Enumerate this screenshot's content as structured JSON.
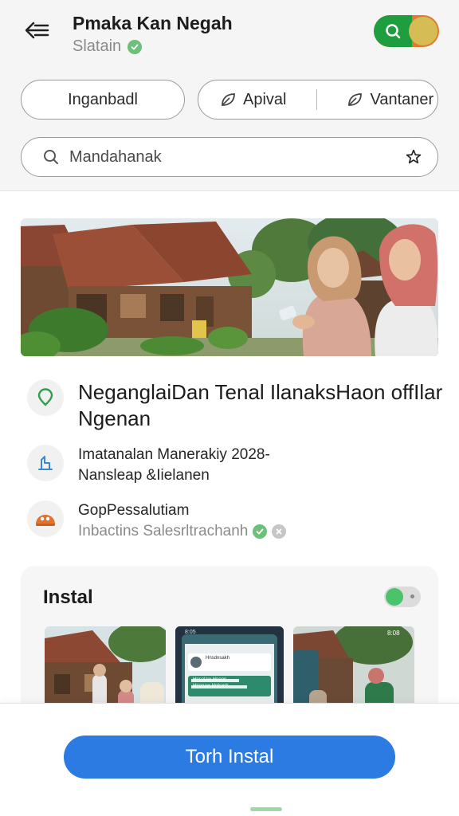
{
  "header": {
    "title": "Pmaka Kan Negah",
    "subtitle": "Slatain"
  },
  "chips": {
    "primary": "Inganbadl",
    "second": "Apival",
    "third": "Vantaner"
  },
  "search": {
    "placeholder": "Mandahanak"
  },
  "info": {
    "headline": "NeganglaiDan Tenal IlanaksHaon offIlar Ngenan",
    "date_line": "Imatanalan Manerakiy 2028-",
    "location_line": "Nansleap &Iielanen",
    "group_title": "GopPessalutiam",
    "group_sub": "Inbactins Salesrltrachanh"
  },
  "card": {
    "title": "Instal",
    "phone_header": "Hnsdnsakh",
    "phone_line1": "Hnsolaw Hnenn",
    "phone_line2": "Hnanaw Hnbanh",
    "status_time": "8:05",
    "status_time_right": "8:08"
  },
  "cta": {
    "label": "Torh Instal"
  },
  "colors": {
    "accent_blue": "#2b7be3",
    "toggle_green": "#1e9e3e",
    "toggle_orange": "#e07a2e",
    "toggle_knob": "#d6bc55",
    "verified_green": "#6dc07a"
  },
  "icons": {
    "back": "arrow-left-icon",
    "search": "search-icon",
    "favorite": "star-outline-icon",
    "chip": "leaf-icon",
    "location": "map-pin-icon",
    "calendar": "calendar-icon",
    "group": "group-icon"
  }
}
